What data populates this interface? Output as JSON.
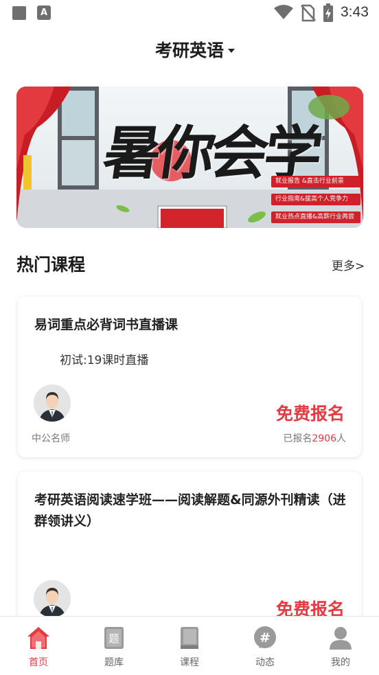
{
  "status_bar": {
    "time": "3:43"
  },
  "header": {
    "title": "考研英语"
  },
  "banner": {
    "headline": "暑你会学",
    "tags": [
      "就业报告 &直击行业前景",
      "行业指南&拔高个人竞争力",
      "就业热点直播&高薪行业再尝"
    ]
  },
  "section": {
    "title": "热门课程",
    "more": "更多>"
  },
  "courses": [
    {
      "title": "易词重点必背词书直播课",
      "subtitle": "初试:19课时直播",
      "teacher": "中公名师",
      "action": "免费报名",
      "enrolled_prefix": "已报名",
      "enrolled_count": "2906",
      "enrolled_suffix": "人"
    },
    {
      "title": "考研英语阅读速学班——阅读解题&同源外刊精读（进群领讲义）",
      "action": "免费报名"
    }
  ],
  "tabs": [
    {
      "label": "首页",
      "icon": "home-icon",
      "active": true
    },
    {
      "label": "题库",
      "icon": "question-bank-icon",
      "active": false
    },
    {
      "label": "课程",
      "icon": "book-icon",
      "active": false
    },
    {
      "label": "动态",
      "icon": "hashtag-icon",
      "active": false
    },
    {
      "label": "我的",
      "icon": "user-icon",
      "active": false
    }
  ],
  "colors": {
    "accent": "#e63a43",
    "inactive": "#9a9a9a"
  }
}
